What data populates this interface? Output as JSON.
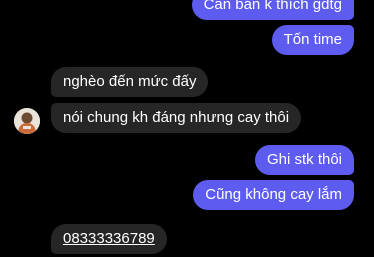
{
  "messages": [
    {
      "id": "m1",
      "side": "out",
      "text": "Cần bán k thích gdtg"
    },
    {
      "id": "m2",
      "side": "out",
      "text": "Tốn time"
    },
    {
      "id": "m3",
      "side": "in",
      "text": "nghèo đến mức đấy"
    },
    {
      "id": "m4",
      "side": "in",
      "text": "nói chung kh đáng nhưng cay thôi"
    },
    {
      "id": "m5",
      "side": "out",
      "text": "Ghi stk thôi"
    },
    {
      "id": "m6",
      "side": "out",
      "text": "Cũng không cay lắm"
    },
    {
      "id": "m7",
      "side": "in",
      "text": "08333336789"
    }
  ],
  "colors": {
    "background": "#000000",
    "outgoing_bubble": "#5e5cf0",
    "incoming_bubble": "#262626",
    "text": "#ffffff"
  },
  "icons": {
    "avatar": "contact-avatar"
  }
}
